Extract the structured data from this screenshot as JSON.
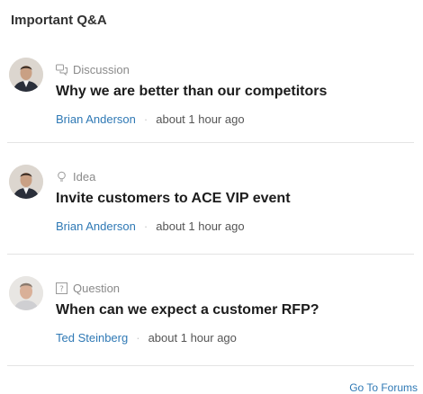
{
  "widget": {
    "title": "Important Q&A",
    "footer_link": "Go To Forums"
  },
  "items": [
    {
      "type_label": "Discussion",
      "type_icon": "discussion-icon",
      "title": "Why we are better than our competitors",
      "author": "Brian Anderson",
      "separator": "·",
      "time": "about 1 hour ago"
    },
    {
      "type_label": "Idea",
      "type_icon": "lightbulb-icon",
      "title": "Invite customers to ACE VIP event",
      "author": "Brian Anderson",
      "separator": "·",
      "time": "about 1 hour ago"
    },
    {
      "type_label": "Question",
      "type_icon": "question-icon",
      "title": "When can we expect a customer RFP?",
      "author": "Ted Steinberg",
      "separator": "·",
      "time": "about 1 hour ago"
    }
  ],
  "colors": {
    "link": "#2f79b5",
    "meta": "#8a8a8a",
    "divider": "#e4e4e4"
  }
}
